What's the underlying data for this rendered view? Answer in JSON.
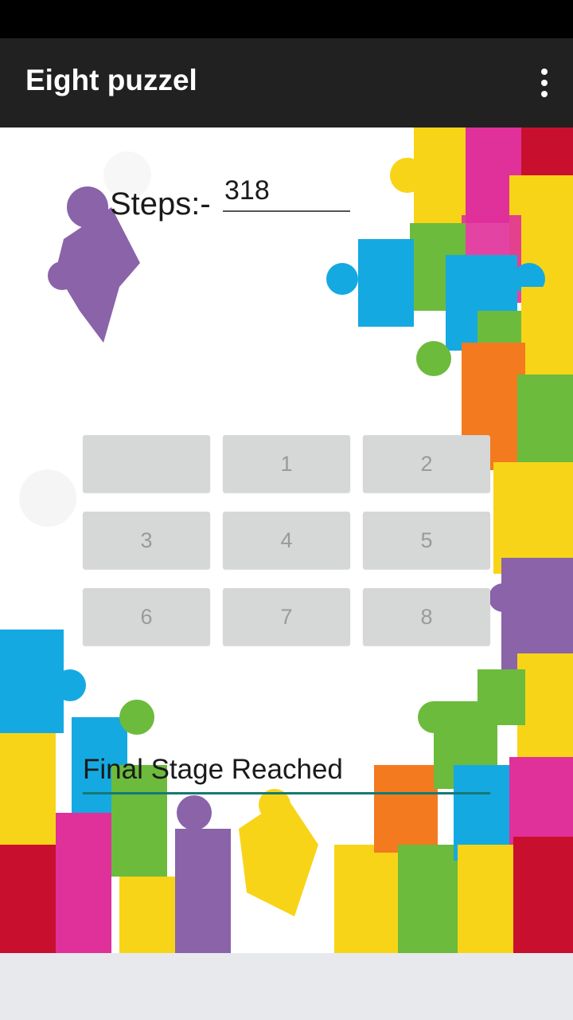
{
  "app": {
    "title": "Eight puzzel"
  },
  "steps": {
    "label": "Steps:-",
    "value": "318"
  },
  "grid": {
    "tiles": [
      "",
      "1",
      "2",
      "3",
      "4",
      "5",
      "6",
      "7",
      "8"
    ]
  },
  "status": {
    "text": "Final Stage Reached"
  },
  "colors": {
    "app_bar": "#212121",
    "tile": "#d6d7d7",
    "status_underline": "#137a73",
    "puzzle_purple": "#8a63a8",
    "puzzle_yellow": "#f7d417",
    "puzzle_pink": "#e0309a",
    "puzzle_red": "#c8102e",
    "puzzle_blue": "#15a9e1",
    "puzzle_green": "#6cbb3c",
    "puzzle_orange": "#f47a20"
  }
}
